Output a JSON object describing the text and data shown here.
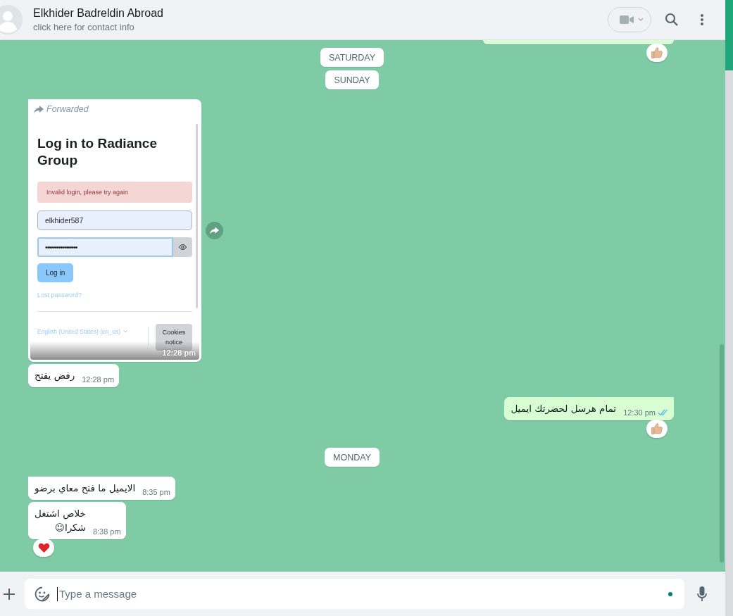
{
  "header": {
    "contact_name": "Elkhider Badreldin Abroad",
    "subtitle": "click here for contact info"
  },
  "messages": [
    {
      "kind": "cut",
      "outgoing": true,
      "reaction": {
        "kind": "thumbs_up"
      }
    },
    {
      "kind": "date",
      "label": "SATURDAY"
    },
    {
      "kind": "date",
      "label": "SUNDAY"
    },
    {
      "kind": "image",
      "outgoing": false,
      "tail": true,
      "forwarded_label": "Forwarded",
      "time": "12:28 pm",
      "screenshot": {
        "title": "Log in to Radiance Group",
        "error": "Invalid login, please try again",
        "username": "elkhider587",
        "password": "•••••••••••••••••",
        "button": "Log in",
        "lost_password": "Lost password?",
        "language": "English (United States) (en_us)",
        "cookies": "Cookies notice"
      }
    },
    {
      "kind": "text",
      "outgoing": false,
      "tail": false,
      "text": "رفض يفتح",
      "time": "12:28 pm"
    },
    {
      "kind": "text",
      "outgoing": true,
      "tail": true,
      "text": "تمام هرسل لحضرتك ايميل",
      "time": "12:30 pm",
      "read": true,
      "reaction": {
        "kind": "thumbs_up"
      }
    },
    {
      "kind": "date",
      "label": "MONDAY"
    },
    {
      "kind": "text",
      "outgoing": false,
      "tail": true,
      "text": "الايميل ما فتح معاي برضو",
      "time": "8:35 pm"
    },
    {
      "kind": "text",
      "outgoing": false,
      "tail": false,
      "text": "خلاص اشتغل\nشكرا☺",
      "time": "8:38 pm",
      "reaction": {
        "kind": "heart"
      }
    }
  ],
  "composer": {
    "placeholder": "Type a message"
  }
}
